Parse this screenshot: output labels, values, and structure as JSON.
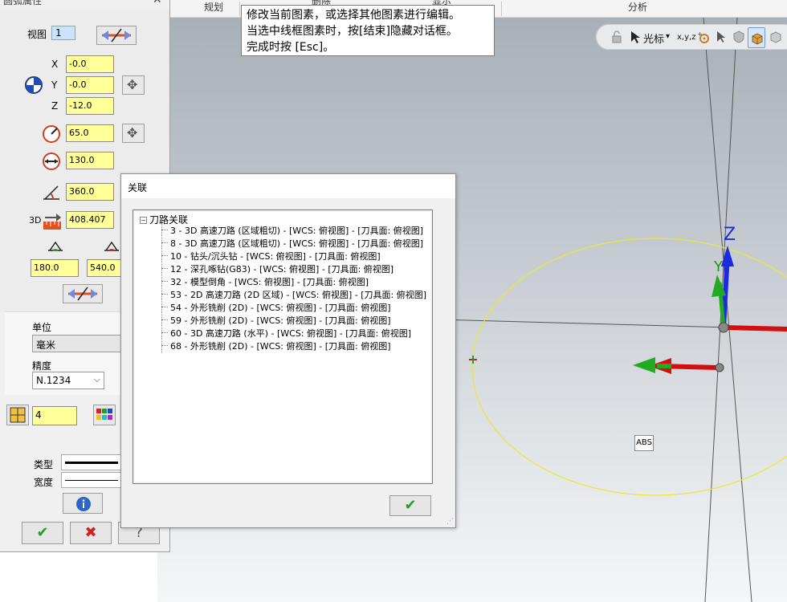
{
  "ribbon": {
    "tabs": [
      "规划",
      "删除",
      "显示",
      "分析"
    ]
  },
  "tooltip": {
    "lines": [
      "修改当前图素，或选择其他图素进行编辑。",
      "当选中线框图素时，按[结束]隐藏对话框。",
      "完成时按 [Esc]。"
    ]
  },
  "view_toolbar": {
    "cursor_label": "光标",
    "xyz_label": "x,y,z"
  },
  "arc_panel": {
    "title": "圆弧属性",
    "view_label": "视图",
    "view_value": "1",
    "x_label": "X",
    "x_value": "-0.0",
    "y_label": "Y",
    "y_value": "-0.0",
    "z_label": "Z",
    "z_value": "-12.0",
    "radius_value": "65.0",
    "diameter_value": "130.0",
    "sweep_value": "360.0",
    "length_label": "3D",
    "length_value": "408.407",
    "start_angle": "180.0",
    "end_angle": "540.0",
    "unit_label": "单位",
    "unit_value": "毫米",
    "precision_label": "精度",
    "precision_value": "N.1234",
    "level_value": "4",
    "type_label": "类型",
    "width_label": "宽度",
    "help_icon": "info-icon",
    "ok_icon": "check-icon",
    "cancel_icon": "x-icon",
    "question_icon": "question-icon"
  },
  "dialog": {
    "title": "关联",
    "root_label": "刀路关联",
    "items": [
      "3 - 3D 高速刀路 (区域粗切) - [WCS: 俯视图] - [刀具面: 俯视图]",
      "8 - 3D 高速刀路 (区域粗切) - [WCS: 俯视图] - [刀具面: 俯视图]",
      "10 - 钻头/沉头钻 - [WCS: 俯视图] - [刀具面: 俯视图]",
      "12 - 深孔啄钻(G83) - [WCS: 俯视图] - [刀具面: 俯视图]",
      "32 - 模型倒角 - [WCS: 俯视图] - [刀具面: 俯视图]",
      "53 - 2D 高速刀路 (2D 区域) - [WCS: 俯视图] - [刀具面: 俯视图]",
      "54 - 外形铣削 (2D) - [WCS: 俯视图] - [刀具面: 俯视图]",
      "59 - 外形铣削 (2D) - [WCS: 俯视图] - [刀具面: 俯视图]",
      "60 - 3D 高速刀路 (水平) - [WCS: 俯视图] - [刀具面: 俯视图]",
      "68 - 外形铣削 (2D) - [WCS: 俯视图] - [刀具面: 俯视图]"
    ]
  },
  "viewport": {
    "abs_label": "ABS",
    "axis_z": "Z",
    "axis_y": "Y"
  },
  "colors": {
    "field_yellow": "#ffff99",
    "arc_yellow": "#e8e83a",
    "axis_red": "#d01010",
    "axis_green": "#22aa22",
    "axis_blue": "#1a2be0"
  }
}
